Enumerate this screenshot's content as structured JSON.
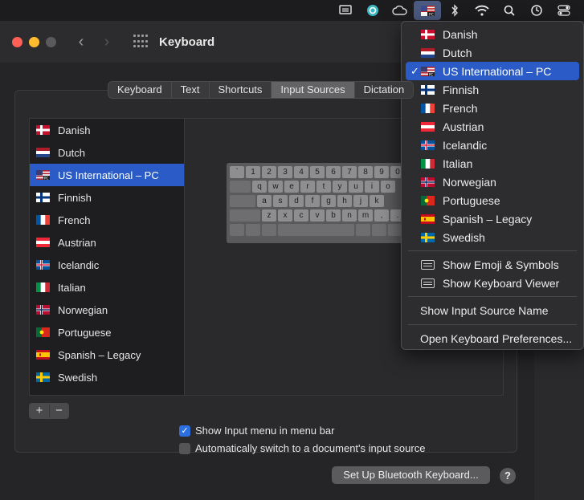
{
  "menubar": {
    "icons": [
      "screen-icon",
      "quill-icon",
      "cloud-icon",
      "input-source-flag-icon",
      "bluetooth-icon",
      "wifi-icon",
      "search-icon",
      "time-machine-icon",
      "control-center-icon"
    ]
  },
  "window": {
    "title": "Keyboard"
  },
  "tabs": [
    {
      "label": "Keyboard"
    },
    {
      "label": "Text"
    },
    {
      "label": "Shortcuts"
    },
    {
      "label": "Input Sources",
      "selected": true
    },
    {
      "label": "Dictation"
    }
  ],
  "input_sources": [
    {
      "label": "Danish",
      "flag": "dk"
    },
    {
      "label": "Dutch",
      "flag": "nl"
    },
    {
      "label": "US International – PC",
      "flag": "us",
      "selected": true
    },
    {
      "label": "Finnish",
      "flag": "fi"
    },
    {
      "label": "French",
      "flag": "fr"
    },
    {
      "label": "Austrian",
      "flag": "at"
    },
    {
      "label": "Icelandic",
      "flag": "is"
    },
    {
      "label": "Italian",
      "flag": "it"
    },
    {
      "label": "Norwegian",
      "flag": "no"
    },
    {
      "label": "Portuguese",
      "flag": "pt"
    },
    {
      "label": "Spanish – Legacy",
      "flag": "es"
    },
    {
      "label": "Swedish",
      "flag": "se"
    }
  ],
  "keyboard_rows": [
    [
      "`",
      "1",
      "2",
      "3",
      "4",
      "5",
      "6",
      "7",
      "8",
      "9",
      "0"
    ],
    [
      "",
      "q",
      "w",
      "e",
      "r",
      "t",
      "y",
      "u",
      "i",
      "o"
    ],
    [
      "",
      "a",
      "s",
      "d",
      "f",
      "g",
      "h",
      "j",
      "k"
    ],
    [
      "",
      "z",
      "x",
      "c",
      "v",
      "b",
      "n",
      "m",
      ",",
      "."
    ]
  ],
  "controls": {
    "add_label": "+",
    "remove_label": "−",
    "show_input_menu_label": "Show Input menu in menu bar",
    "show_input_menu_checked": true,
    "auto_switch_label": "Automatically switch to a document's input source",
    "auto_switch_checked": false,
    "bluetooth_button": "Set Up Bluetooth Keyboard...",
    "help_button": "?"
  },
  "dropdown": {
    "sources": [
      {
        "label": "Danish",
        "flag": "dk"
      },
      {
        "label": "Dutch",
        "flag": "nl"
      },
      {
        "label": "US International – PC",
        "flag": "us",
        "selected": true
      },
      {
        "label": "Finnish",
        "flag": "fi"
      },
      {
        "label": "French",
        "flag": "fr"
      },
      {
        "label": "Austrian",
        "flag": "at"
      },
      {
        "label": "Icelandic",
        "flag": "is"
      },
      {
        "label": "Italian",
        "flag": "it"
      },
      {
        "label": "Norwegian",
        "flag": "no"
      },
      {
        "label": "Portuguese",
        "flag": "pt"
      },
      {
        "label": "Spanish – Legacy",
        "flag": "es"
      },
      {
        "label": "Swedish",
        "flag": "se"
      }
    ],
    "check_mark": "✓",
    "show_emoji": "Show Emoji & Symbols",
    "show_keyboard_viewer": "Show Keyboard Viewer",
    "show_input_source_name": "Show Input Source Name",
    "open_keyboard_prefs": "Open Keyboard Preferences..."
  }
}
